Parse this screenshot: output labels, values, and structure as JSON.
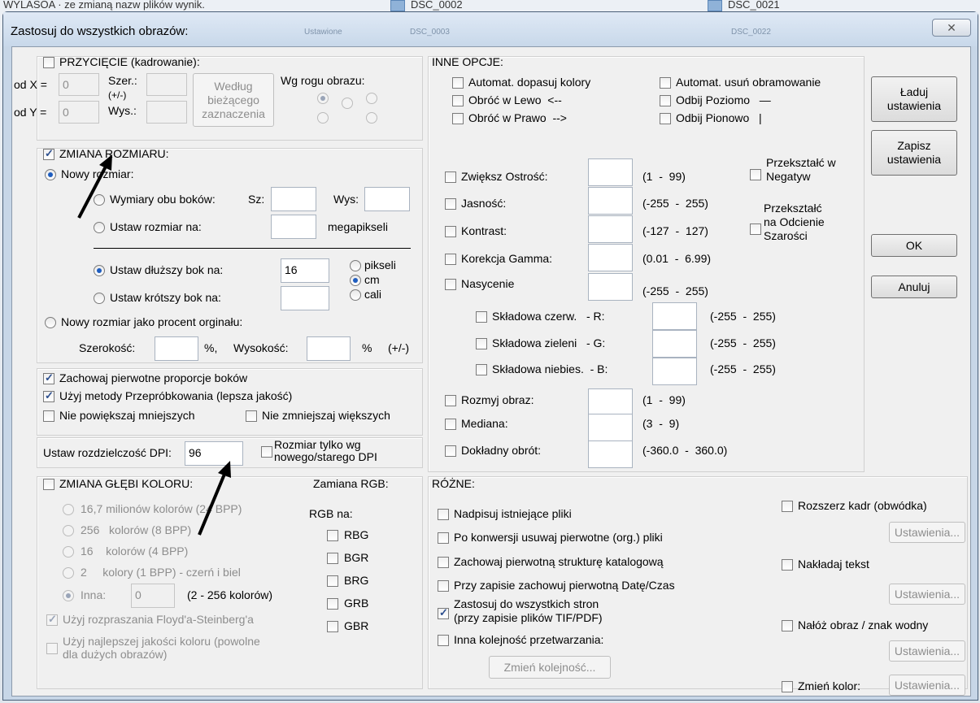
{
  "background": {
    "top_left": "WYLASOA · ze zmianą nazw plików wynik.",
    "file1": "DSC_0002",
    "file2": "DSC_0021",
    "sub1": "Ustawione",
    "sub2": "DSC_0003",
    "sub3": "DSC_0022"
  },
  "dialog": {
    "title": "Zastosuj do wszystkich obrazów:",
    "close": "✕"
  },
  "crop": {
    "label": "PRZYCIĘCIE (kadrowanie):",
    "odx": "od X =",
    "odx_val": "0",
    "ody": "od Y =",
    "ody_val": "0",
    "szer": "Szer.:",
    "pm": "(+/-)",
    "wys": "Wys.:",
    "btn": "Według\nbieżącego\nzaznaczenia",
    "corner": "Wg rogu obrazu:"
  },
  "resize": {
    "label": "ZMIANA ROZMIARU:",
    "new_size": "Nowy rozmiar:",
    "both": "Wymiary obu boków:",
    "sz": "Sz:",
    "wys": "Wys:",
    "set_to": "Ustaw rozmiar na:",
    "mpx": "megapikseli",
    "longer": "Ustaw dłuższy bok na:",
    "longer_val": "16",
    "pixels": "pikseli",
    "cm": "cm",
    "inches": "cali",
    "shorter": "Ustaw krótszy bok na:",
    "percent": "Nowy rozmiar jako procent orginału:",
    "width": "Szerokość:",
    "pct1": "%,",
    "height": "Wysokość:",
    "pct2": "%",
    "pm": "(+/-)"
  },
  "keep": {
    "proportions": "Zachowaj pierwotne proporcje boków",
    "resample": "Użyj metody Przepróbkowania (lepsza jakość)",
    "no_enlarge": "Nie powiększaj mniejszych",
    "no_shrink": "Nie zmniejszaj większych"
  },
  "dpi": {
    "label": "Ustaw rozdzielczość DPI:",
    "value": "96",
    "only": "Rozmiar tylko wg\nnowego/starego DPI"
  },
  "depth": {
    "label": "ZMIANA GŁĘBI KOLORU:",
    "o1": "16,7 milionów kolorów (24 BPP)",
    "o2": "256   kolorów (8 BPP)",
    "o3": "16    kolorów (4 BPP)",
    "o4": "2     kolory (1 BPP) - czerń i biel",
    "other": "Inna:",
    "other_val": "0",
    "range": "(2 - 256 kolorów)",
    "dither": "Użyj rozpraszania Floyd'a-Steinberg'a",
    "best": "Użyj najlepszej jakości koloru (powolne\ndla dużych obrazów)"
  },
  "rgb": {
    "label": "Zamiana RGB:",
    "to": "RGB na:",
    "items": [
      "RBG",
      "BGR",
      "BRG",
      "GRB",
      "GBR"
    ]
  },
  "other": {
    "label": "INNE OPCJE:",
    "auto_color": "Automat. dopasuj kolory",
    "auto_border": "Automat. usuń obramowanie",
    "rot_left": "Obróć w Lewo  <--",
    "rot_right": "Obróć w Prawo  -->",
    "flip_h": "Odbij Poziomo   —",
    "flip_v": "Odbij Pionowo   |"
  },
  "adj": {
    "sharp": "Zwiększ Ostrość:",
    "sharp_r": "(1  -  99)",
    "bright": "Jasność:",
    "bright_r": "(-255  -  255)",
    "contrast": "Kontrast:",
    "contrast_r": "(-127  -  127)",
    "gamma": "Korekcja Gamma:",
    "gamma_r": "(0.01  -  6.99)",
    "sat": "Nasycenie",
    "sat_r": "(-255  -  255)",
    "red": "Składowa czerw.   - R:",
    "red_r": "(-255  -  255)",
    "green": "Składowa zieleni   - G:",
    "green_r": "(-255  -  255)",
    "blue": "Składowa niebies.  - B:",
    "blue_r": "(-255  -  255)",
    "blur": "Rozmyj obraz:",
    "blur_r": "(1  -  99)",
    "median": "Mediana:",
    "median_r": "(3  -  9)",
    "rotate": "Dokładny obrót:",
    "rotate_r": "(-360.0  -  360.0)",
    "negative": "Przekształć w\nNegatyw",
    "gray": "Przekształć\nna Odcienie\nSzarości"
  },
  "misc": {
    "label": "RÓŻNE:",
    "overwrite": "Nadpisuj istniejące pliki",
    "delete": "Po konwersji usuwaj pierwotne (org.) pliki",
    "keep_dirs": "Zachowaj pierwotną strukturę katalogową",
    "keep_date": "Przy zapisie zachowuj pierwotną Datę/Czas",
    "all_pages": "Zastosuj do wszystkich stron\n(przy zapisie plików TIF/PDF)",
    "order": "Inna kolejność przetwarzania:",
    "order_btn": "Zmień kolejność...",
    "canvas": "Rozszerz kadr (obwódka)",
    "text": "Nakładaj tekst",
    "watermark": "Nałóż obraz / znak wodny",
    "color": "Zmień kolor:",
    "settings": "Ustawienia..."
  },
  "buttons": {
    "load": "Ładuj\nustawienia",
    "save": "Zapisz\nustawienia",
    "ok": "OK",
    "cancel": "Anuluj"
  }
}
